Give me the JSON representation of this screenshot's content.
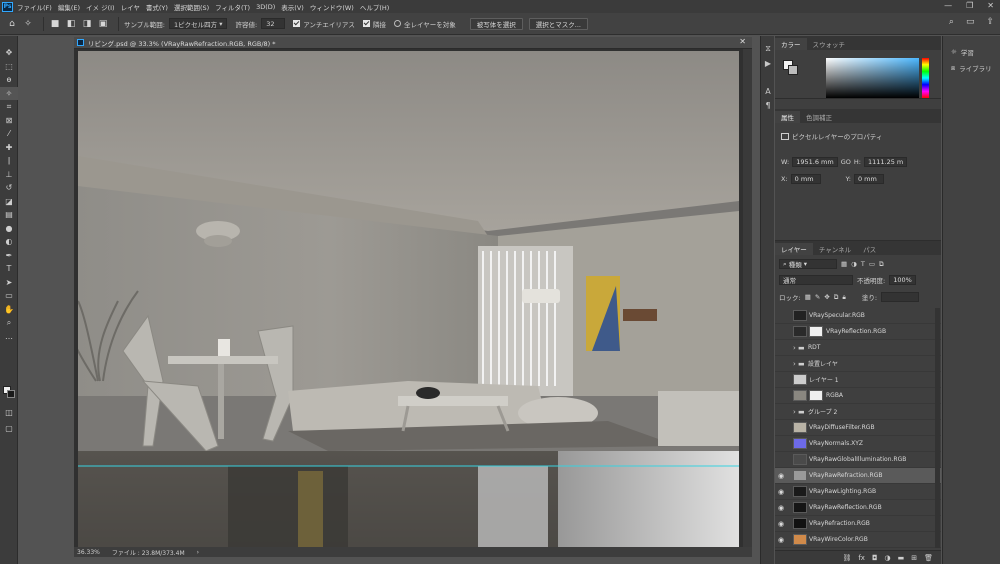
{
  "menubar": {
    "items": [
      "ファイル(F)",
      "編集(E)",
      "イメ",
      "ジ(I)",
      "レイヤ",
      "書式(Y)",
      "選択範囲(S)",
      "フィルタ",
      "(T)",
      "3D(D)",
      "表示(V)",
      "ウィンドウ(W)",
      "ヘルプ(H)"
    ]
  },
  "optionsbar": {
    "sample_size_label": "サンプル範囲:",
    "sample_size_value": "1ピクセル四方",
    "tolerance_label": "許容値:",
    "tolerance_value": "32",
    "antialias_label": "アンチエイリアス",
    "contiguous_label": "隣接",
    "all_layers_label": "全レイヤーを対象",
    "select_subject_label": "被写体を選択",
    "select_mask_label": "選択とマスク..."
  },
  "document": {
    "tab_title": "リビング.psd @ 33.3% (VRayRawRefraction.RGB, RGB/8) *",
    "zoom": "36.33%",
    "file_info": "ファイル : 23.8M/373.4M"
  },
  "color_panel": {
    "tabs": [
      "カラー",
      "スウォッチ"
    ]
  },
  "properties_panel": {
    "tabs": [
      "属性",
      "色調補正"
    ],
    "layer_type_label": "ピクセルレイヤーのプロパティ",
    "w_label": "W:",
    "w_value": "1951.6 mm",
    "go_label": "GO",
    "h_label": "H:",
    "h_value": "1111.25 m",
    "x_label": "X:",
    "x_value": "0 mm",
    "y_label": "Y:",
    "y_value": "0 mm"
  },
  "layers_panel": {
    "tabs": [
      "レイヤー",
      "チャンネル",
      "パス"
    ],
    "filter_value": "種類",
    "blend_mode": "通常",
    "opacity_label": "不透明度:",
    "opacity_value": "100%",
    "lock_label": "ロック:",
    "fill_label": "塗り:",
    "layers": [
      {
        "name": "VRaySpecular.RGB",
        "kind": "pixel",
        "thumb": "#222"
      },
      {
        "name": "VRayReflection.RGB",
        "kind": "pixel-mask",
        "thumb": "#2a2a2a"
      },
      {
        "name": "RDT",
        "kind": "group",
        "thumb": ""
      },
      {
        "name": "設置レイヤ",
        "kind": "group",
        "thumb": ""
      },
      {
        "name": "レイヤー 1",
        "kind": "pixel",
        "thumb": "#ccc"
      },
      {
        "name": "RGBA",
        "kind": "pixel-mask",
        "thumb": "#8a8780"
      },
      {
        "name": "グループ 2",
        "kind": "group",
        "thumb": ""
      },
      {
        "name": "VRayDiffuseFilter.RGB",
        "kind": "pixel",
        "thumb": "#b9b3a6"
      },
      {
        "name": "VRayNormals.XYZ",
        "kind": "pixel",
        "thumb": "#6d6ae8"
      },
      {
        "name": "VRayRawGlobalIllumination.RGB",
        "kind": "pixel",
        "thumb": "#4a4a4a"
      },
      {
        "name": "VRayRawRefraction.RGB",
        "kind": "pixel",
        "thumb": "#9a9a9a"
      },
      {
        "name": "VRayRawLighting.RGB",
        "kind": "pixel",
        "thumb": "#1a1a1a"
      },
      {
        "name": "VRayRawReflection.RGB",
        "kind": "pixel",
        "thumb": "#151515"
      },
      {
        "name": "VRayRefraction.RGB",
        "kind": "pixel",
        "thumb": "#111"
      },
      {
        "name": "VRayWireColor.RGB",
        "kind": "pixel",
        "thumb": "#d08a4a"
      }
    ]
  },
  "learn_panel": {
    "items": [
      "学習",
      "ライブラリ"
    ]
  },
  "colors": {
    "accent": "#31a8ff",
    "selected_layer": "#5a5a5a",
    "guide_line": "#37d2e0"
  }
}
